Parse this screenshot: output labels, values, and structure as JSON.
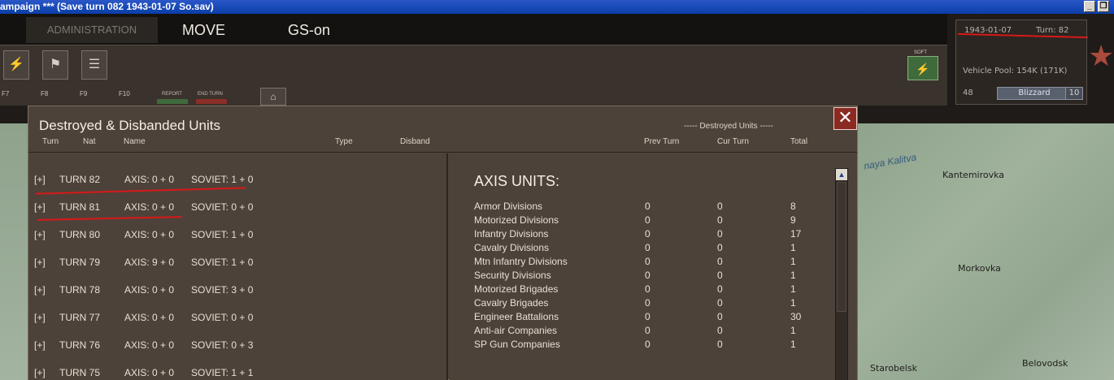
{
  "window": {
    "title": "ampaign  ***  (Save turn 082 1943-01-07 So.sav)",
    "btn_min": "_",
    "btn_restore": "❐"
  },
  "topbar": {
    "tabs": [
      {
        "label": "ADMINISTRATION"
      },
      {
        "label": "MOVE"
      },
      {
        "label": "GS-on"
      }
    ]
  },
  "toolbar": {
    "fkeys": [
      "F7",
      "F8",
      "F9",
      "F10"
    ],
    "report_label": "REPORT",
    "end_turn_label": "END TURN",
    "soft_label": "SOFT"
  },
  "info": {
    "date": "1943-01-07",
    "turn": "Turn: 82",
    "vehicle_pool": "Vehicle Pool: 154K (171K)",
    "value_48": "48",
    "weather": "Blizzard",
    "value_10": "10"
  },
  "map": {
    "towns": [
      "Kantemirovka",
      "Morkovka",
      "Belovodsk",
      "Starobelsk"
    ],
    "river": "naya Kalitva"
  },
  "dialog": {
    "title": "Destroyed & Disbanded Units",
    "destroyed_header": "----- Destroyed Units -----",
    "close": "✕",
    "columns": {
      "turn": "Turn",
      "nat": "Nat",
      "name": "Name",
      "type": "Type",
      "disband": "Disband",
      "prev_turn": "Prev Turn",
      "cur_turn": "Cur Turn",
      "total": "Total"
    },
    "turns": [
      {
        "exp": "[+]",
        "turn": "TURN 82",
        "axis": "AXIS: 0 + 0",
        "soviet": "SOVIET: 1 + 0"
      },
      {
        "exp": "[+]",
        "turn": "TURN 81",
        "axis": "AXIS: 0 + 0",
        "soviet": "SOVIET: 0 + 0"
      },
      {
        "exp": "[+]",
        "turn": "TURN 80",
        "axis": "AXIS: 0 + 0",
        "soviet": "SOVIET: 1 + 0"
      },
      {
        "exp": "[+]",
        "turn": "TURN 79",
        "axis": "AXIS: 9 + 0",
        "soviet": "SOVIET: 1 + 0"
      },
      {
        "exp": "[+]",
        "turn": "TURN 78",
        "axis": "AXIS: 0 + 0",
        "soviet": "SOVIET: 3 + 0"
      },
      {
        "exp": "[+]",
        "turn": "TURN 77",
        "axis": "AXIS: 0 + 0",
        "soviet": "SOVIET: 0 + 0"
      },
      {
        "exp": "[+]",
        "turn": "TURN 76",
        "axis": "AXIS: 0 + 0",
        "soviet": "SOVIET: 0 + 3"
      },
      {
        "exp": "[+]",
        "turn": "TURN 75",
        "axis": "AXIS: 0 + 0",
        "soviet": "SOVIET: 1 + 1"
      }
    ],
    "axis_title": "AXIS UNITS:",
    "units": [
      {
        "name": "Armor Divisions",
        "prev": "0",
        "cur": "0",
        "total": "8"
      },
      {
        "name": "Motorized Divisions",
        "prev": "0",
        "cur": "0",
        "total": "9"
      },
      {
        "name": "Infantry Divisions",
        "prev": "0",
        "cur": "0",
        "total": "17"
      },
      {
        "name": "Cavalry Divisions",
        "prev": "0",
        "cur": "0",
        "total": "1"
      },
      {
        "name": "Mtn Infantry Divisions",
        "prev": "0",
        "cur": "0",
        "total": "1"
      },
      {
        "name": "Security Divisions",
        "prev": "0",
        "cur": "0",
        "total": "1"
      },
      {
        "name": "Motorized Brigades",
        "prev": "0",
        "cur": "0",
        "total": "1"
      },
      {
        "name": "Cavalry Brigades",
        "prev": "0",
        "cur": "0",
        "total": "1"
      },
      {
        "name": "Engineer Battalions",
        "prev": "0",
        "cur": "0",
        "total": "30"
      },
      {
        "name": "Anti-air Companies",
        "prev": "0",
        "cur": "0",
        "total": "1"
      },
      {
        "name": "SP Gun Companies",
        "prev": "0",
        "cur": "0",
        "total": "1"
      }
    ],
    "scroll_up": "▲"
  }
}
